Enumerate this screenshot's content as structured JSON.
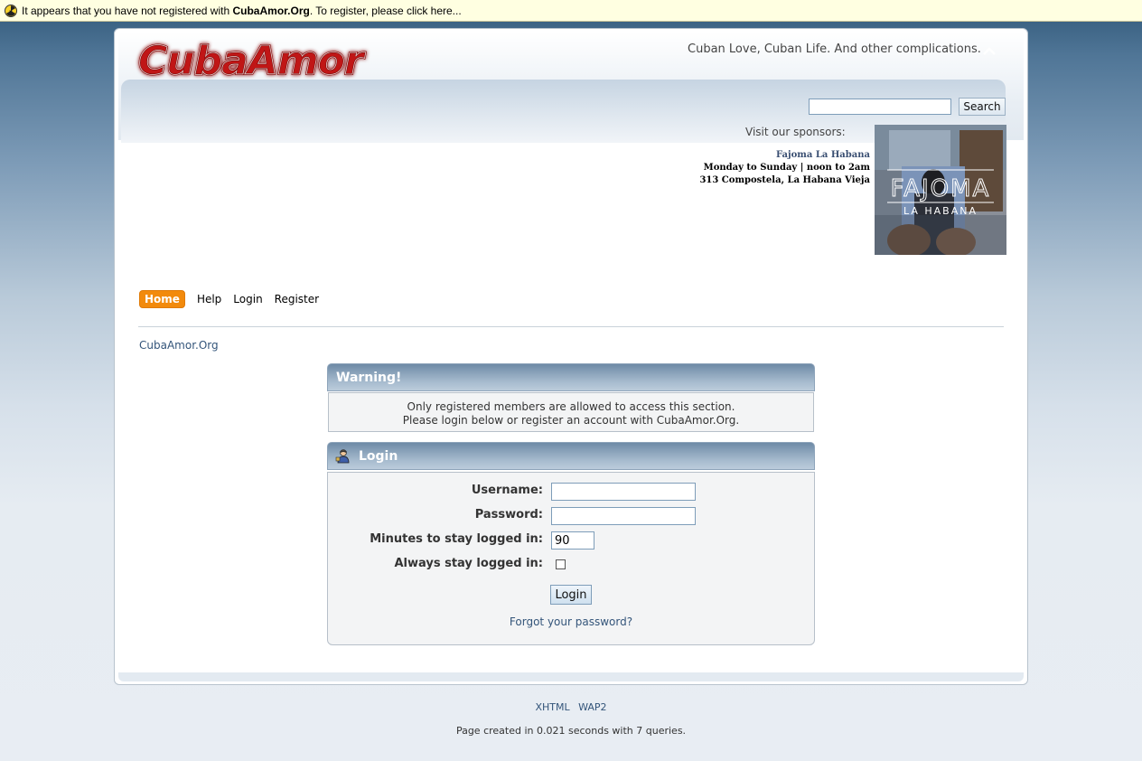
{
  "notice": {
    "text_before": "It appears that you have not registered with ",
    "site_name": "CubaAmor.Org",
    "text_after": ". To register, please click here..."
  },
  "header": {
    "logo_text": "CubaAmor",
    "tagline": "Cuban Love, Cuban Life. And other complications.",
    "search_placeholder": "",
    "search_button": "Search",
    "sponsors_label": "Visit our sponsors:",
    "sponsor": {
      "name": "Fajoma La Habana",
      "hours": "Monday to Sunday | noon to 2am",
      "address": "313 Compostela, La Habana Vieja",
      "image_title": "FAJOMA",
      "image_subtitle": "LA HABANA"
    }
  },
  "nav": {
    "items": [
      "Home",
      "Help",
      "Login",
      "Register"
    ],
    "active": "Home"
  },
  "breadcrumb": "CubaAmor.Org",
  "warning": {
    "title": "Warning!",
    "line1": "Only registered members are allowed to access this section.",
    "line2": "Please login below or register an account with CubaAmor.Org."
  },
  "login": {
    "title": "Login",
    "username_label": "Username:",
    "password_label": "Password:",
    "minutes_label": "Minutes to stay logged in:",
    "minutes_value": "90",
    "always_label": "Always stay logged in:",
    "button": "Login",
    "forgot": "Forgot your password?"
  },
  "footer": {
    "links": [
      "XHTML",
      "WAP2"
    ],
    "stats": "Page created in 0.021 seconds with 7 queries."
  },
  "colors": {
    "accent": "#f28a0c",
    "link": "#34557a",
    "notice_bg": "#ffffe1",
    "logo_red": "#b01010"
  }
}
